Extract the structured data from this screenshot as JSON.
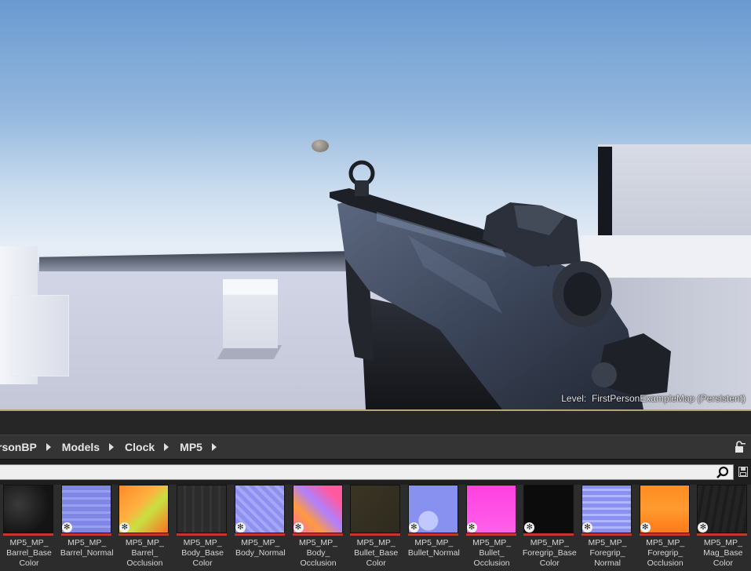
{
  "viewport": {
    "level_prefix": "Level:",
    "level_name": "FirstPersonExampleMap (Persistent)"
  },
  "breadcrumb": {
    "items": [
      "rsonBP",
      "Models",
      "Clock",
      "MP5"
    ]
  },
  "search": {
    "value": "",
    "placeholder": ""
  },
  "icons": {
    "lock": "lock-icon",
    "search": "search-icon",
    "save": "save-icon",
    "path_arrow": "chevron-right-icon"
  },
  "colors": {
    "texture_type_bar": "#c0392b",
    "breadcrumb_bg": "#343434",
    "viewport_border": "#b8a47a"
  },
  "assets": [
    {
      "name": "MP5_MP_\nBarrel_Base\nColor",
      "badge": false,
      "thumb": "t-dark"
    },
    {
      "name": "MP5_MP_\nBarrel_Normal",
      "badge": true,
      "thumb": "t-blue"
    },
    {
      "name": "MP5_MP_\nBarrel_\nOcclusion",
      "badge": true,
      "thumb": "t-orange"
    },
    {
      "name": "MP5_MP_\nBody_Base\nColor",
      "badge": false,
      "thumb": "t-body-base"
    },
    {
      "name": "MP5_MP_\nBody_Normal",
      "badge": true,
      "thumb": "t-body-normal"
    },
    {
      "name": "MP5_MP_\nBody_\nOcclusion",
      "badge": true,
      "thumb": "t-body-occ"
    },
    {
      "name": "MP5_MP_\nBullet_Base\nColor",
      "badge": false,
      "thumb": "t-bullet-base"
    },
    {
      "name": "MP5_MP_\nBullet_Normal",
      "badge": true,
      "thumb": "t-bullet-normal"
    },
    {
      "name": "MP5_MP_\nBullet_\nOcclusion",
      "badge": true,
      "thumb": "t-bullet-occ"
    },
    {
      "name": "MP5_MP_\nForegrip_Base\nColor",
      "badge": true,
      "thumb": "t-fore-base"
    },
    {
      "name": "MP5_MP_\nForegrip_\nNormal",
      "badge": true,
      "thumb": "t-fore-normal"
    },
    {
      "name": "MP5_MP_\nForegrip_\nOcclusion",
      "badge": true,
      "thumb": "t-fore-occ"
    },
    {
      "name": "MP5_MP_\nMag_Base\nColor",
      "badge": true,
      "thumb": "t-mag-base"
    }
  ]
}
